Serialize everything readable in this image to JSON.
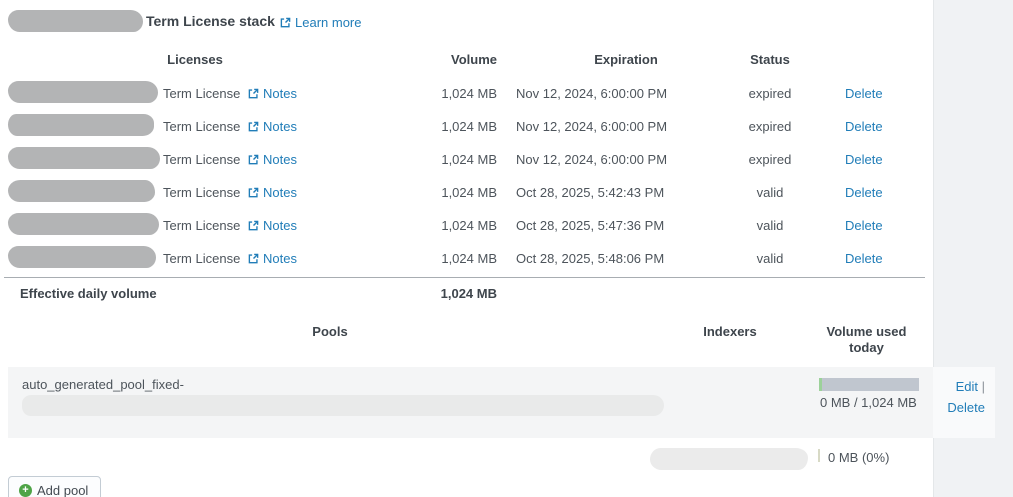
{
  "header": {
    "title": "Term License stack",
    "learn_more_label": "Learn more"
  },
  "licenses_table": {
    "columns": {
      "licenses": "Licenses",
      "volume": "Volume",
      "expiration": "Expiration",
      "status": "Status"
    },
    "rows": [
      {
        "type": "Term License",
        "notes_label": "Notes",
        "volume": "1,024 MB",
        "expiration": "Nov 12, 2024, 6:00:00 PM",
        "status": "expired",
        "delete_label": "Delete"
      },
      {
        "type": "Term License",
        "notes_label": "Notes",
        "volume": "1,024 MB",
        "expiration": "Nov 12, 2024, 6:00:00 PM",
        "status": "expired",
        "delete_label": "Delete"
      },
      {
        "type": "Term License",
        "notes_label": "Notes",
        "volume": "1,024 MB",
        "expiration": "Nov 12, 2024, 6:00:00 PM",
        "status": "expired",
        "delete_label": "Delete"
      },
      {
        "type": "Term License",
        "notes_label": "Notes",
        "volume": "1,024 MB",
        "expiration": "Oct 28, 2025, 5:42:43 PM",
        "status": "valid",
        "delete_label": "Delete"
      },
      {
        "type": "Term License",
        "notes_label": "Notes",
        "volume": "1,024 MB",
        "expiration": "Oct 28, 2025, 5:47:36 PM",
        "status": "valid",
        "delete_label": "Delete"
      },
      {
        "type": "Term License",
        "notes_label": "Notes",
        "volume": "1,024 MB",
        "expiration": "Oct 28, 2025, 5:48:06 PM",
        "status": "valid",
        "delete_label": "Delete"
      }
    ],
    "summary": {
      "label": "Effective daily volume",
      "value": "1,024 MB"
    }
  },
  "pools_table": {
    "columns": {
      "pools": "Pools",
      "indexers": "Indexers",
      "volume_used": "Volume used today"
    },
    "pool": {
      "name_prefix": "auto_generated_pool_fixed-",
      "volume_used": "0 MB / 1,024 MB",
      "actions": {
        "edit": "Edit",
        "separator": "|",
        "delete": "Delete"
      }
    },
    "total_row": {
      "volume_used": "0 MB (0%)"
    }
  },
  "add_pool_button": {
    "label": "Add pool"
  },
  "colors": {
    "link_blue": "#217db8",
    "button_green": "#4fa447",
    "bar_fill_green": "#9cd19a",
    "bar_track_gray": "#c0c6cf",
    "pool_row_bg": "#f4f5f6",
    "right_rail_bg": "#f0f2f4"
  }
}
